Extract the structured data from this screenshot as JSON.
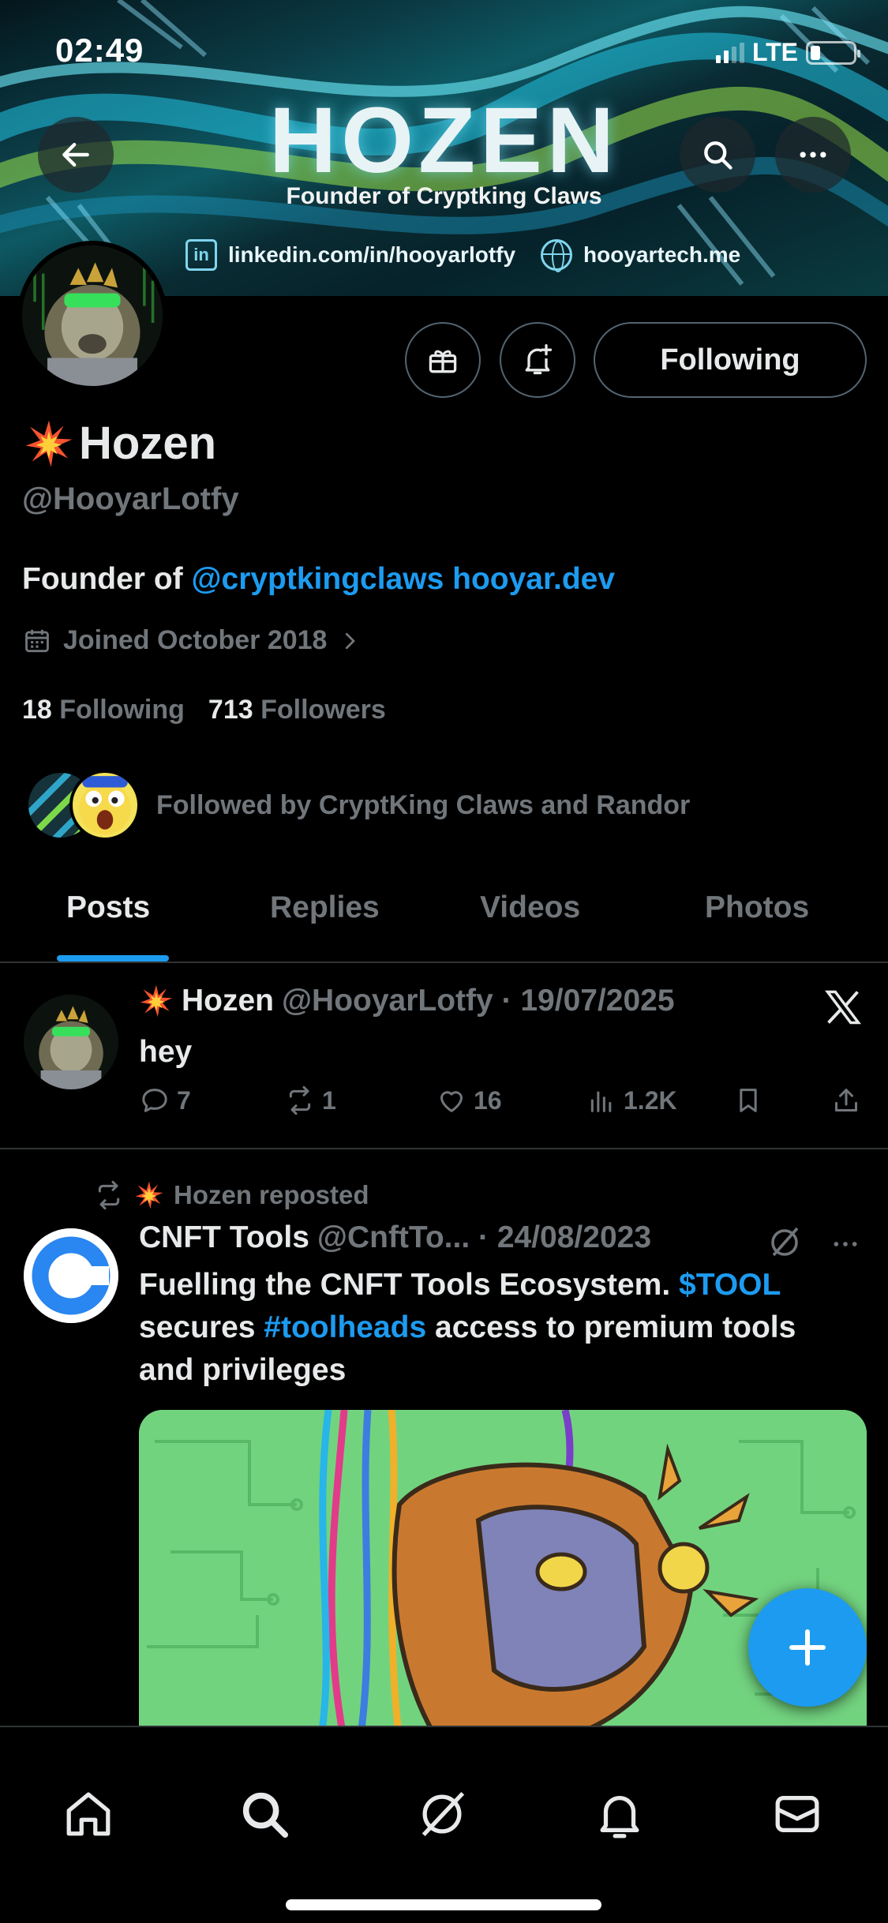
{
  "status_bar": {
    "time": "02:49",
    "network": "LTE"
  },
  "banner": {
    "title": "HOZEN",
    "subtitle": "Founder of Cryptking Claws",
    "linkedin_icon_text": "in",
    "linkedin": "linkedin.com/in/hooyarlotfy",
    "website": "hooyartech.me"
  },
  "profile": {
    "display_name": "Hozen",
    "handle": "@HooyarLotfy",
    "bio_prefix": "Founder of ",
    "bio_mention": "@cryptkingclaws",
    "bio_link": "hooyar.dev",
    "joined": "Joined October 2018",
    "following_count": "18",
    "following_label": "Following",
    "followers_count": "713",
    "followers_label": "Followers",
    "followed_by": "Followed by CryptKing Claws and Randor",
    "follow_button": "Following"
  },
  "tabs": [
    {
      "label": "Posts",
      "active": true
    },
    {
      "label": "Replies",
      "active": false
    },
    {
      "label": "Videos",
      "active": false
    },
    {
      "label": "Photos",
      "active": false
    }
  ],
  "posts": [
    {
      "author": "Hozen",
      "meta": "@HooyarLotfy · 19/07/2025",
      "text": "hey",
      "replies": "7",
      "reposts": "1",
      "likes": "16",
      "views": "1.2K"
    },
    {
      "repost_label": "Hozen reposted",
      "author": "CNFT Tools",
      "meta": "@CnftTo... · 24/08/2023",
      "text_1": "Fuelling the CNFT Tools Ecosystem. ",
      "cashtag": "$TOOL",
      "text_2": "secures ",
      "hashtag": "#toolheads",
      "text_3": " access to premium tools",
      "text_4": "and privileges"
    }
  ],
  "icons": {
    "back": "back-arrow-icon",
    "search": "search-icon",
    "more": "more-icon",
    "gift": "gift-icon",
    "notify": "bell-plus-icon",
    "x_logo": "x-logo-icon",
    "grok": "grok-icon"
  },
  "colors": {
    "accent": "#1d9bf0",
    "muted": "#71767b",
    "text": "#e7e9ea",
    "divider": "#2f3336"
  }
}
